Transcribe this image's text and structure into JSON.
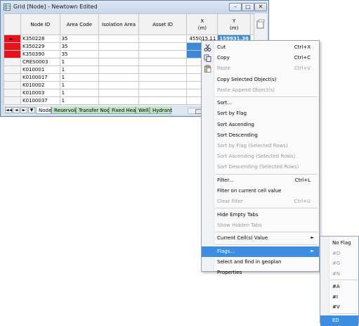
{
  "window": {
    "title": "Grid [Node] - Newtown Edited",
    "minimize": "–",
    "maximize": "□",
    "close": "✕"
  },
  "grid": {
    "columns": [
      {
        "key": "node_id",
        "label": "Node ID",
        "unit": ""
      },
      {
        "key": "area_code",
        "label": "Area Code",
        "unit": ""
      },
      {
        "key": "isolation_area",
        "label": "Isolation Area",
        "unit": ""
      },
      {
        "key": "asset_id",
        "label": "Asset ID",
        "unit": ""
      },
      {
        "key": "x",
        "label": "X",
        "unit": "(m)"
      },
      {
        "key": "y",
        "label": "Y",
        "unit": "(m)"
      }
    ],
    "rows": [
      {
        "flag": true,
        "current": true,
        "node_id": "K350228",
        "area_code": "35",
        "isolation_area": "",
        "asset_id": "",
        "x": "455015.11",
        "y": "159931.36",
        "x_hl": false,
        "y_hl": true
      },
      {
        "flag": true,
        "current": false,
        "node_id": "K350229",
        "area_code": "35",
        "isolation_area": "",
        "asset_id": "",
        "x": "4",
        "y": "",
        "x_hl": true,
        "y_hl": false
      },
      {
        "flag": true,
        "current": false,
        "node_id": "K350390",
        "area_code": "35",
        "isolation_area": "",
        "asset_id": "",
        "x": "4",
        "y": "",
        "x_hl": true,
        "y_hl": false
      },
      {
        "flag": false,
        "current": false,
        "node_id": "CRES0003",
        "area_code": "1",
        "isolation_area": "",
        "asset_id": "",
        "x": "4",
        "y": "",
        "x_hl": false,
        "y_hl": false
      },
      {
        "flag": false,
        "current": false,
        "node_id": "K010001",
        "area_code": "1",
        "isolation_area": "",
        "asset_id": "",
        "x": "4",
        "y": "",
        "x_hl": false,
        "y_hl": false
      },
      {
        "flag": false,
        "current": false,
        "node_id": "K0100017",
        "area_code": "1",
        "isolation_area": "",
        "asset_id": "",
        "x": "4",
        "y": "",
        "x_hl": false,
        "y_hl": false
      },
      {
        "flag": false,
        "current": false,
        "node_id": "K010002",
        "area_code": "1",
        "isolation_area": "",
        "asset_id": "",
        "x": "4",
        "y": "",
        "x_hl": false,
        "y_hl": false
      },
      {
        "flag": false,
        "current": false,
        "node_id": "K010003",
        "area_code": "1",
        "isolation_area": "",
        "asset_id": "",
        "x": "4",
        "y": "",
        "x_hl": false,
        "y_hl": false
      },
      {
        "flag": false,
        "current": false,
        "node_id": "K0100037",
        "area_code": "1",
        "isolation_area": "",
        "asset_id": "",
        "x": "4",
        "y": "",
        "x_hl": false,
        "y_hl": false
      }
    ],
    "current_row_marker": "►"
  },
  "tabs": {
    "nav": [
      "◄◄",
      "◄",
      "►",
      "▼"
    ],
    "items": [
      {
        "label": "Node",
        "active": true
      },
      {
        "label": "Reservoir",
        "active": false
      },
      {
        "label": "Transfer Node",
        "active": false
      },
      {
        "label": "Fixed Head",
        "active": false
      },
      {
        "label": "Well",
        "active": false
      },
      {
        "label": "Hydrant",
        "active": false
      }
    ]
  },
  "context_menu": {
    "items": [
      {
        "type": "item",
        "label": "Cut",
        "shortcut": "Ctrl+X",
        "disabled": false,
        "icon": "scissors-icon"
      },
      {
        "type": "item",
        "label": "Copy",
        "shortcut": "Ctrl+C",
        "disabled": false,
        "icon": "copy-icon"
      },
      {
        "type": "item",
        "label": "Paste",
        "shortcut": "Ctrl+V",
        "disabled": true,
        "icon": "paste-icon"
      },
      {
        "type": "item",
        "label": "Copy Selected Object(s)",
        "shortcut": "",
        "disabled": false
      },
      {
        "type": "item",
        "label": "Paste Append Object(s)",
        "shortcut": "",
        "disabled": true
      },
      {
        "type": "sep"
      },
      {
        "type": "item",
        "label": "Sort...",
        "shortcut": "",
        "disabled": false
      },
      {
        "type": "item",
        "label": "Sort by Flag",
        "shortcut": "",
        "disabled": false
      },
      {
        "type": "item",
        "label": "Sort Ascending",
        "shortcut": "",
        "disabled": false
      },
      {
        "type": "item",
        "label": "Sort Descending",
        "shortcut": "",
        "disabled": false
      },
      {
        "type": "item",
        "label": "Sort by Flag (Selected Rows)",
        "shortcut": "",
        "disabled": true
      },
      {
        "type": "item",
        "label": "Sort Ascending (Selected Rows)",
        "shortcut": "",
        "disabled": true
      },
      {
        "type": "item",
        "label": "Sort Descending (Selected Rows)",
        "shortcut": "",
        "disabled": true
      },
      {
        "type": "sep"
      },
      {
        "type": "item",
        "label": "Filter...",
        "shortcut": "Ctrl+L",
        "disabled": false
      },
      {
        "type": "item",
        "label": "Filter on current cell value",
        "shortcut": "",
        "disabled": false
      },
      {
        "type": "item",
        "label": "Clear filter",
        "shortcut": "Ctrl+U",
        "disabled": true
      },
      {
        "type": "sep"
      },
      {
        "type": "item",
        "label": "Hide Empty Tabs",
        "shortcut": "",
        "disabled": false
      },
      {
        "type": "item",
        "label": "Show Hidden Tabs",
        "shortcut": "",
        "disabled": true
      },
      {
        "type": "sep"
      },
      {
        "type": "item",
        "label": "Current Cell(s) Value",
        "shortcut": "",
        "disabled": false,
        "submenu": true
      },
      {
        "type": "sep"
      },
      {
        "type": "item",
        "label": "Flags...",
        "shortcut": "",
        "disabled": false,
        "submenu": true,
        "hot": true
      },
      {
        "type": "item",
        "label": "Select and find in geoplan",
        "shortcut": "",
        "disabled": false
      },
      {
        "type": "item",
        "label": "Properties",
        "shortcut": "",
        "disabled": false
      }
    ],
    "submenu_arrow": "►"
  },
  "flags_submenu": {
    "items": [
      {
        "type": "item",
        "label": "No Flag",
        "disabled": false
      },
      {
        "type": "item",
        "label": "#D",
        "disabled": true
      },
      {
        "type": "item",
        "label": "#G",
        "disabled": true
      },
      {
        "type": "item",
        "label": "#N",
        "disabled": true
      },
      {
        "type": "sep"
      },
      {
        "type": "item",
        "label": "#A",
        "disabled": false
      },
      {
        "type": "item",
        "label": "#I",
        "disabled": false
      },
      {
        "type": "item",
        "label": "#V",
        "disabled": false
      },
      {
        "type": "sep"
      },
      {
        "type": "item",
        "label": "ED",
        "disabled": false,
        "hot": true
      }
    ]
  },
  "colors": {
    "flag_red": "#e8121a",
    "highlight_blue": "#3a8ad6",
    "menu_hot": "#3d8ee0",
    "tab_green": "#bfe3bf"
  }
}
